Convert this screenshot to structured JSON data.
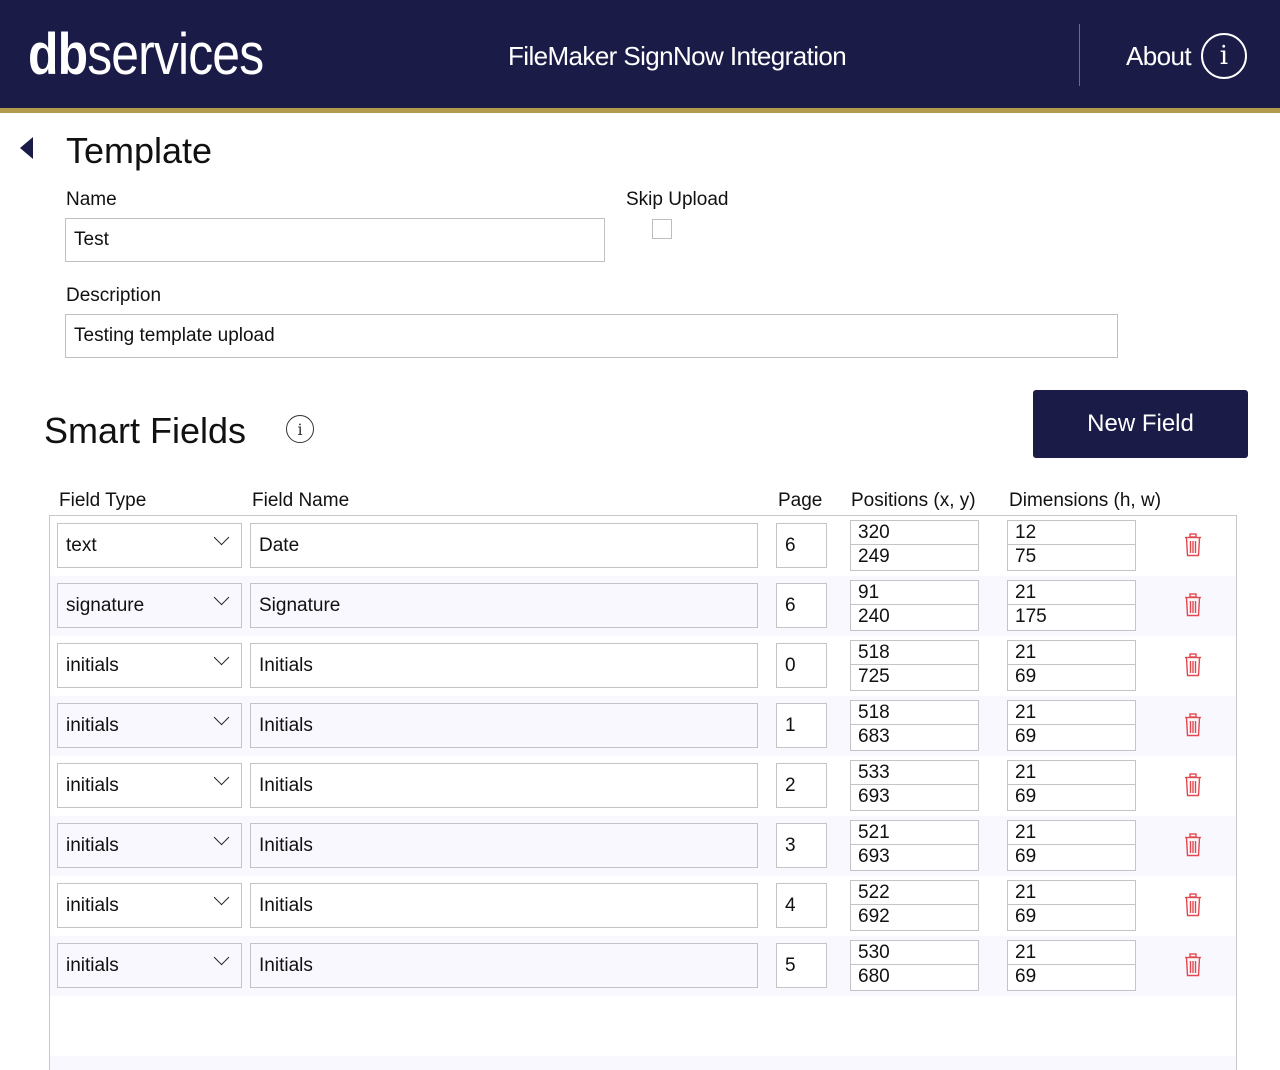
{
  "header": {
    "logo_bold": "db",
    "logo_light": "services",
    "app_title": "FileMaker SignNow Integration",
    "about_label": "About",
    "about_icon": "info-icon"
  },
  "template": {
    "title": "Template",
    "back_icon": "back-arrow-icon",
    "name_label": "Name",
    "name_value": "Test",
    "skip_upload_label": "Skip Upload",
    "skip_upload_checked": false,
    "description_label": "Description",
    "description_value": "Testing template upload"
  },
  "smart_fields": {
    "title": "Smart Fields",
    "info_icon": "info-icon",
    "new_field_label": "New Field",
    "columns": {
      "field_type": "Field Type",
      "field_name": "Field Name",
      "page": "Page",
      "positions": "Positions (x, y)",
      "dimensions": "Dimensions (h, w)"
    },
    "rows": [
      {
        "type": "text",
        "name": "Date",
        "page": "6",
        "x": "320",
        "y": "249",
        "h": "12",
        "w": "75"
      },
      {
        "type": "signature",
        "name": "Signature",
        "page": "6",
        "x": "91",
        "y": "240",
        "h": "21",
        "w": "175"
      },
      {
        "type": "initials",
        "name": "Initials",
        "page": "0",
        "x": "518",
        "y": "725",
        "h": "21",
        "w": "69"
      },
      {
        "type": "initials",
        "name": "Initials",
        "page": "1",
        "x": "518",
        "y": "683",
        "h": "21",
        "w": "69"
      },
      {
        "type": "initials",
        "name": "Initials",
        "page": "2",
        "x": "533",
        "y": "693",
        "h": "21",
        "w": "69"
      },
      {
        "type": "initials",
        "name": "Initials",
        "page": "3",
        "x": "521",
        "y": "693",
        "h": "21",
        "w": "69"
      },
      {
        "type": "initials",
        "name": "Initials",
        "page": "4",
        "x": "522",
        "y": "692",
        "h": "21",
        "w": "69"
      },
      {
        "type": "initials",
        "name": "Initials",
        "page": "5",
        "x": "530",
        "y": "680",
        "h": "21",
        "w": "69"
      }
    ],
    "delete_icon": "trash-icon"
  },
  "colors": {
    "brand_navy": "#1b1b48",
    "accent_gold": "#b09a4c",
    "delete_red": "#e0494f",
    "row_alt": "#f8f8fe"
  }
}
